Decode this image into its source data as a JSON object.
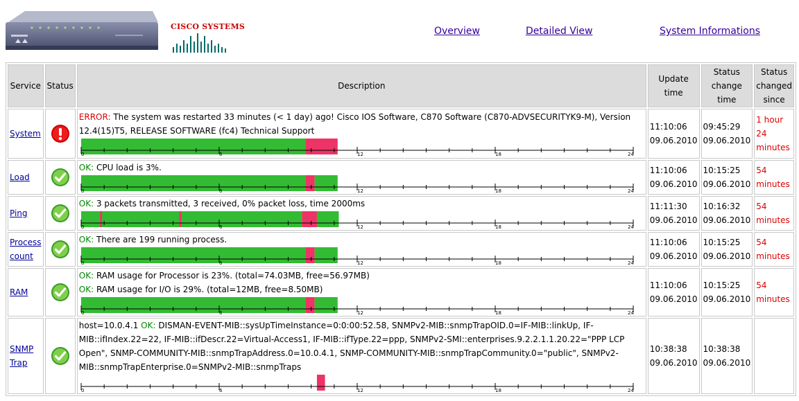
{
  "nav": {
    "overview": "Overview",
    "detailed": "Detailed View",
    "sysinfo": "System Informations"
  },
  "logo": {
    "text": "CISCO SYSTEMS"
  },
  "headers": {
    "service": "Service",
    "status": "Status",
    "description": "Description",
    "update_time": "Update time",
    "status_change_time": "Status change time",
    "status_changed_since": "Status changed since"
  },
  "axis_labels": [
    "0",
    "6",
    "12",
    "18",
    "24"
  ],
  "colors": {
    "ok": "#33bb33",
    "error": "#ee3366",
    "link": "#330099",
    "err_text": "#dd0000",
    "ok_text": "#008800"
  },
  "rows": [
    {
      "service_l1": "System",
      "service_l2": "",
      "status": "error",
      "prefix": "ERROR:",
      "text": " The system was restarted 33 minutes (< 1 day) ago! Cisco IOS Software, C870 Software (C870-ADVSECURITYK9-M), Version 12.4(15)T5, RELEASE SOFTWARE (fc4) Technical Support",
      "update_time": "11:10:06",
      "update_date": "09.06.2010",
      "change_time": "09:45:29",
      "change_date": "09.06.2010",
      "since": "1 hour 24 minutes",
      "since_l1": "1 hour",
      "since_l2": "24",
      "since_l3": "minutes"
    },
    {
      "service_l1": "Load",
      "service_l2": "",
      "status": "ok",
      "prefix": "OK:",
      "text": " CPU load is 3%.",
      "update_time": "11:10:06",
      "update_date": "09.06.2010",
      "change_time": "10:15:25",
      "change_date": "09.06.2010",
      "since_l1": "54",
      "since_l2": "minutes"
    },
    {
      "service_l1": "Ping",
      "service_l2": "",
      "status": "ok",
      "prefix": "OK:",
      "text": " 3 packets transmitted, 3 received, 0% packet loss, time 2000ms",
      "update_time": "11:11:30",
      "update_date": "09.06.2010",
      "change_time": "10:16:32",
      "change_date": "09.06.2010",
      "since_l1": "54",
      "since_l2": "minutes"
    },
    {
      "service_l1": "Process",
      "service_l2": "count",
      "status": "ok",
      "prefix": "OK:",
      "text": " There are 199 running process.",
      "update_time": "11:10:06",
      "update_date": "09.06.2010",
      "change_time": "10:15:25",
      "change_date": "09.06.2010",
      "since_l1": "54",
      "since_l2": "minutes"
    },
    {
      "service_l1": "RAM",
      "service_l2": "",
      "status": "ok",
      "prefix": "OK:",
      "text": " RAM usage for Processor is 23%. (total=74.03MB, free=56.97MB)",
      "prefix2": "OK:",
      "text2": " RAM usage for I/O is 29%. (total=12MB, free=8.50MB)",
      "update_time": "11:10:06",
      "update_date": "09.06.2010",
      "change_time": "10:15:25",
      "change_date": "09.06.2010",
      "since_l1": "54",
      "since_l2": "minutes"
    },
    {
      "service_l1": "SNMP",
      "service_l2": "Trap",
      "status": "ok",
      "host": "host=10.0.4.1 ",
      "prefix": "OK:",
      "text": " DISMAN-EVENT-MIB::sysUpTimeInstance=0:0:00:52.58, SNMPv2-MIB::snmpTrapOID.0=IF-MIB::linkUp, IF-MIB::ifIndex.22=22, IF-MIB::ifDescr.22=Virtual-Access1, IF-MIB::ifType.22=ppp, SNMPv2-SMI::enterprises.9.2.2.1.1.20.22=\"PPP LCP Open\", SNMP-COMMUNITY-MIB::snmpTrapAddress.0=10.0.4.1, SNMP-COMMUNITY-MIB::snmpTrapCommunity.0=\"public\", SNMPv2-MIB::snmpTrapEnterprise.0=SNMPv2-MIB::snmpTraps",
      "update_time": "10:38:38",
      "update_date": "09.06.2010",
      "change_time": "10:38:38",
      "change_date": "09.06.2010",
      "since_l1": "",
      "since_l2": ""
    }
  ],
  "timelines": [
    {
      "segments": [
        {
          "from": 0,
          "to": 9.75,
          "state": "ok"
        },
        {
          "from": 9.75,
          "to": 11.15,
          "state": "error"
        }
      ],
      "marks": []
    },
    {
      "segments": [
        {
          "from": 0,
          "to": 9.75,
          "state": "ok"
        },
        {
          "from": 9.75,
          "to": 10.15,
          "state": "error"
        },
        {
          "from": 10.15,
          "to": 11.15,
          "state": "ok"
        }
      ],
      "marks": []
    },
    {
      "segments": [
        {
          "from": 0,
          "to": 9.6,
          "state": "ok"
        },
        {
          "from": 9.6,
          "to": 10.25,
          "state": "error"
        },
        {
          "from": 10.25,
          "to": 11.2,
          "state": "ok"
        }
      ],
      "marks": [
        0.85,
        4.3
      ]
    },
    {
      "segments": [
        {
          "from": 0,
          "to": 9.75,
          "state": "ok"
        },
        {
          "from": 9.75,
          "to": 10.15,
          "state": "error"
        },
        {
          "from": 10.15,
          "to": 11.15,
          "state": "ok"
        }
      ],
      "marks": []
    },
    {
      "segments": [
        {
          "from": 0,
          "to": 9.75,
          "state": "ok"
        },
        {
          "from": 9.75,
          "to": 10.15,
          "state": "error"
        },
        {
          "from": 10.15,
          "to": 11.15,
          "state": "ok"
        }
      ],
      "marks": []
    },
    {
      "segments": [
        {
          "from": 10.25,
          "to": 10.6,
          "state": "error"
        }
      ],
      "marks": []
    }
  ]
}
